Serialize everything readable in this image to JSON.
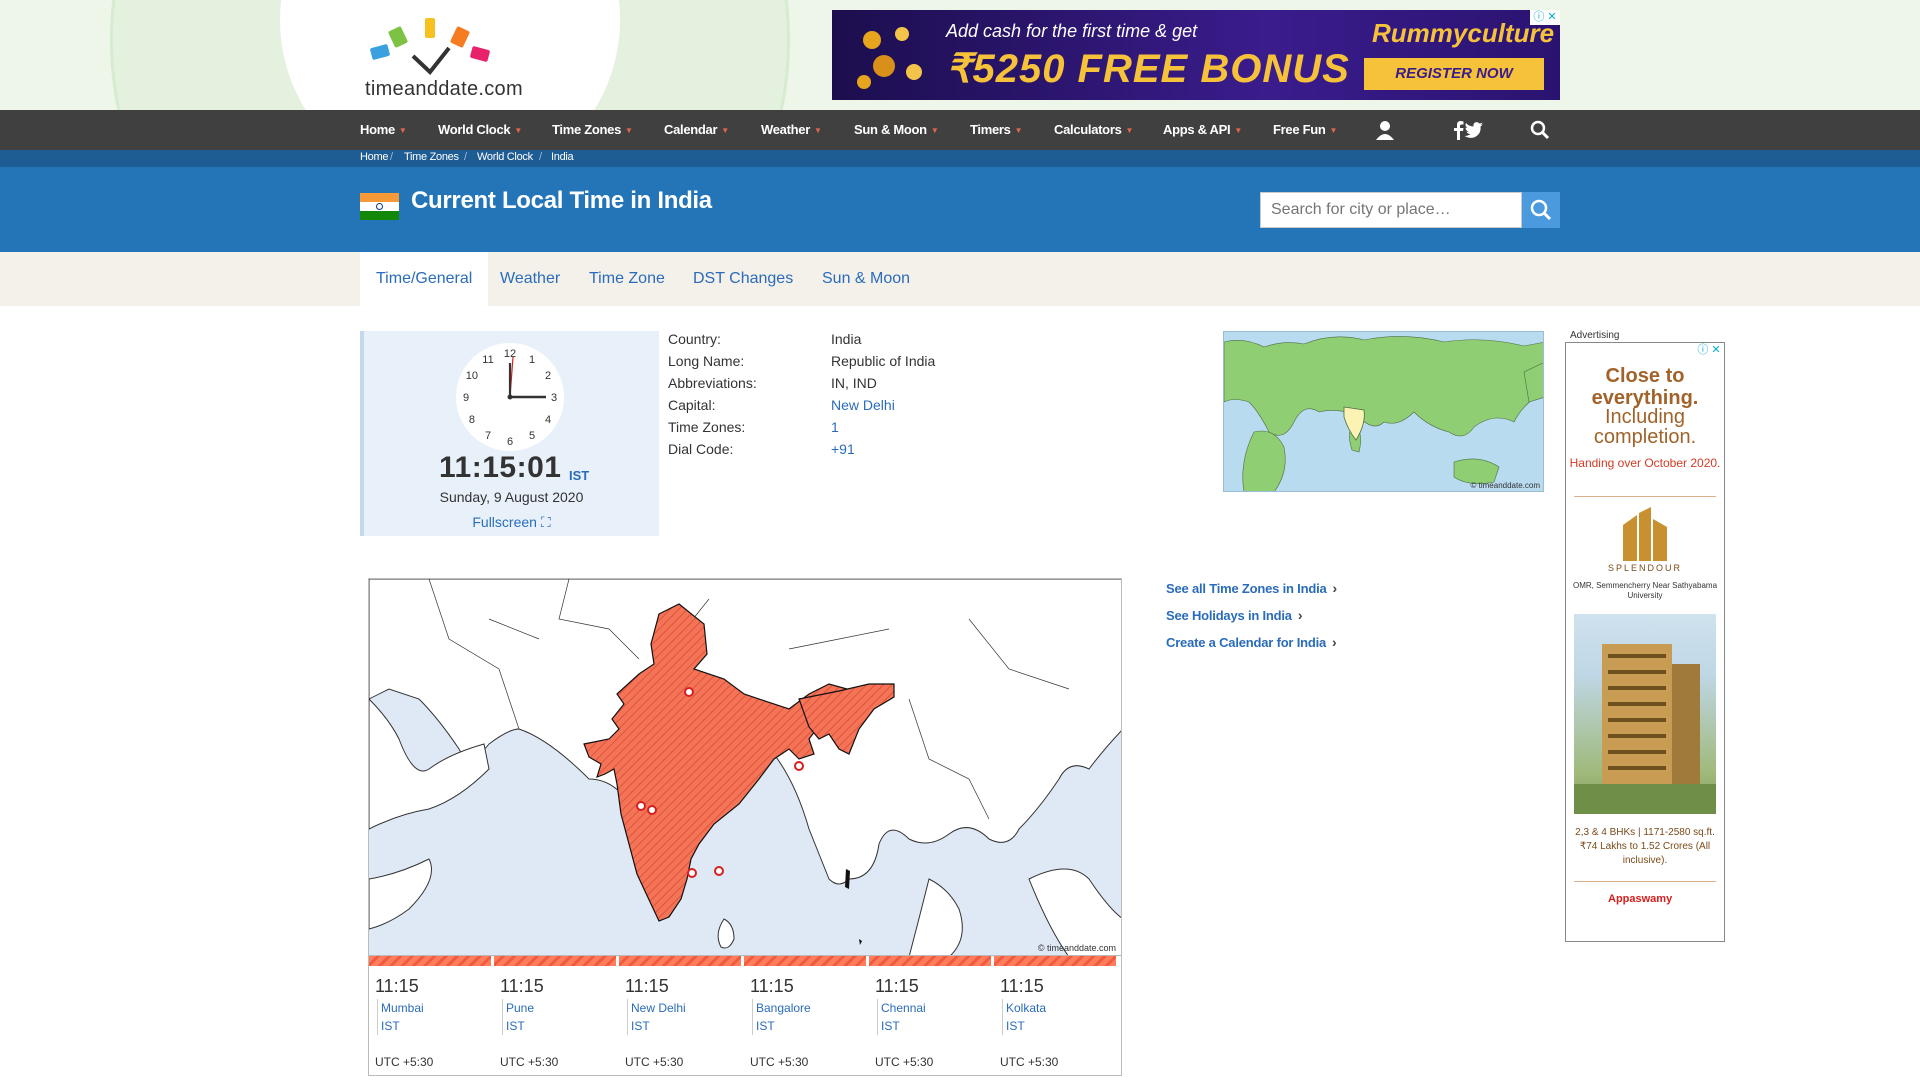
{
  "logo": {
    "text": "timeanddate.com"
  },
  "top_ad": {
    "line1": "Add cash for the first time & get",
    "line2": "₹5250 FREE BONUS",
    "brand": "Rummyculture",
    "cta": "REGISTER NOW",
    "adchoice": "ⓘ ✕"
  },
  "nav": {
    "items": [
      {
        "label": "Home"
      },
      {
        "label": "World Clock"
      },
      {
        "label": "Time Zones"
      },
      {
        "label": "Calendar"
      },
      {
        "label": "Weather"
      },
      {
        "label": "Sun & Moon"
      },
      {
        "label": "Timers"
      },
      {
        "label": "Calculators"
      },
      {
        "label": "Apps & API"
      },
      {
        "label": "Free Fun"
      }
    ],
    "icons": [
      "user-icon",
      "facebook-icon",
      "twitter-icon",
      "search-icon"
    ]
  },
  "breadcrumb": [
    "Home",
    "Time Zones",
    "World Clock",
    "India"
  ],
  "header": {
    "title": "Current Local Time in India",
    "search_placeholder": "Search for city or place…"
  },
  "tabs": [
    {
      "label": "Time/General",
      "active": true
    },
    {
      "label": "Weather"
    },
    {
      "label": "Time Zone"
    },
    {
      "label": "DST Changes"
    },
    {
      "label": "Sun & Moon"
    }
  ],
  "clock": {
    "time": "11:15:01",
    "tz": "IST",
    "date": "Sunday, 9 August 2020",
    "fullscreen": "Fullscreen ⛶",
    "numerals": [
      "12",
      "1",
      "2",
      "3",
      "4",
      "5",
      "6",
      "7",
      "8",
      "9",
      "10",
      "11"
    ]
  },
  "info": [
    {
      "label": "Country:",
      "value": "India"
    },
    {
      "label": "Long Name:",
      "value": "Republic of India"
    },
    {
      "label": "Abbreviations:",
      "value": "IN, IND"
    },
    {
      "label": "Capital:",
      "value": "New Delhi",
      "link": true
    },
    {
      "label": "Time Zones:",
      "value": "1",
      "link": true
    },
    {
      "label": "Dial Code:",
      "value": "+91",
      "link": true
    }
  ],
  "world_map": {
    "credit": "© timeanddate.com"
  },
  "big_map": {
    "credit": "© timeanddate.com"
  },
  "cities": [
    {
      "time": "11:15",
      "name": "Mumbai",
      "tz": "IST",
      "utc": "UTC +5:30"
    },
    {
      "time": "11:15",
      "name": "Pune",
      "tz": "IST",
      "utc": "UTC +5:30"
    },
    {
      "time": "11:15",
      "name": "New Delhi",
      "tz": "IST",
      "utc": "UTC +5:30"
    },
    {
      "time": "11:15",
      "name": "Bangalore",
      "tz": "IST",
      "utc": "UTC +5:30"
    },
    {
      "time": "11:15",
      "name": "Chennai",
      "tz": "IST",
      "utc": "UTC +5:30"
    },
    {
      "time": "11:15",
      "name": "Kolkata",
      "tz": "IST",
      "utc": "UTC +5:30"
    }
  ],
  "side_links": [
    {
      "label": "See all Time Zones in India"
    },
    {
      "label": "See Holidays in India"
    },
    {
      "label": "Create a Calendar for India"
    }
  ],
  "right_ad": {
    "label": "Advertising",
    "h1": "Close to everything.",
    "h2": "Including completion.",
    "h3": "Handing over October 2020.",
    "brand": "SPLENDOUR",
    "addr": "OMR, Semmencherry Near Sathyabama University",
    "price": "2,3 & 4 BHKs | 1171-2580 sq.ft. ₹74 Lakhs to 1.52 Crores (All inclusive).",
    "developer": "Appaswamy"
  },
  "colors": {
    "nav_bg": "#404040",
    "title_bg": "#2474b8",
    "crumb_bg": "#1e5c94",
    "link": "#2a6cba",
    "india_fill": "#f26a4f"
  }
}
